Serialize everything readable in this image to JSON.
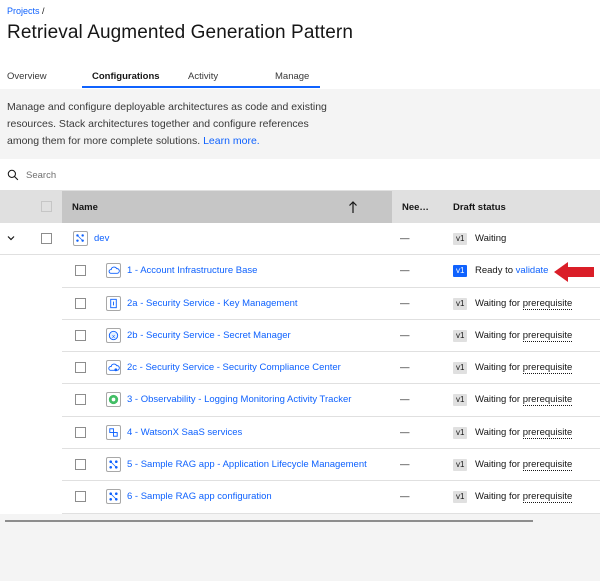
{
  "breadcrumb": {
    "projects": "Projects",
    "separator": " /"
  },
  "page_title": "Retrieval Augmented Generation Pattern",
  "tabs": [
    {
      "label": "Overview",
      "active": false
    },
    {
      "label": "Configurations",
      "active": true
    },
    {
      "label": "Activity",
      "active": false
    },
    {
      "label": "Manage",
      "active": false
    }
  ],
  "description": {
    "text": "Manage and configure deployable architectures as code and existing resources. Stack architectures together and configure references among them for more complete solutions. ",
    "link": "Learn more."
  },
  "search": {
    "placeholder": "Search"
  },
  "table": {
    "headers": {
      "name": "Name",
      "needs": "Nee…",
      "draft_status": "Draft status"
    },
    "group": {
      "name": "dev",
      "needs": "—",
      "version": "v1",
      "status": "Waiting"
    },
    "rows": [
      {
        "name": "1 - Account Infrastructure Base",
        "needs": "—",
        "version": "v1",
        "status_prefix": "Ready to ",
        "status_link": "validate",
        "icon": "cloud-icon"
      },
      {
        "name": "2a - Security Service - Key Management",
        "needs": "—",
        "version": "v1",
        "status_prefix": "Waiting for ",
        "status_link": "prerequisite",
        "icon": "key-icon"
      },
      {
        "name": "2b - Security Service - Secret Manager",
        "needs": "—",
        "version": "v1",
        "status_prefix": "Waiting for ",
        "status_link": "prerequisite",
        "icon": "secret-icon"
      },
      {
        "name": "2c - Security Service - Security Compliance Center",
        "needs": "—",
        "version": "v1",
        "status_prefix": "Waiting for ",
        "status_link": "prerequisite",
        "icon": "cloud-shield-icon"
      },
      {
        "name": "3 - Observability - Logging Monitoring Activity Tracker",
        "needs": "—",
        "version": "v1",
        "status_prefix": "Waiting for ",
        "status_link": "prerequisite",
        "icon": "observability-icon"
      },
      {
        "name": "4 - WatsonX SaaS services",
        "needs": "—",
        "version": "v1",
        "status_prefix": "Waiting for ",
        "status_link": "prerequisite",
        "icon": "watsonx-icon"
      },
      {
        "name": "5 - Sample RAG app - Application Lifecycle Management",
        "needs": "—",
        "version": "v1",
        "status_prefix": "Waiting for ",
        "status_link": "prerequisite",
        "icon": "pipeline-icon"
      },
      {
        "name": "6 - Sample RAG app configuration",
        "needs": "—",
        "version": "v1",
        "status_prefix": "Waiting for ",
        "status_link": "prerequisite",
        "icon": "pipeline-icon"
      }
    ]
  },
  "colors": {
    "link": "#0f62fe",
    "annotation_arrow": "#da1e28"
  }
}
